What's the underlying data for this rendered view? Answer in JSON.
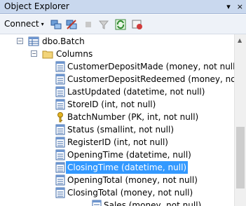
{
  "panel": {
    "title": "Object Explorer",
    "pin_glyph": "▾",
    "close_glyph": "×"
  },
  "toolbar": {
    "connect_label": "Connect",
    "caret": "▾",
    "icons": [
      "connect-object-icon",
      "disconnect-icon",
      "stop-icon",
      "filter-icon",
      "refresh-icon",
      "activity-monitor-icon"
    ]
  },
  "tree": {
    "table_node": "dbo.Batch",
    "columns_folder": "Columns",
    "columns": [
      {
        "label": "CustomerDepositMade (money, not null)",
        "icon": "column-icon"
      },
      {
        "label": "CustomerDepositRedeemed (money, not",
        "icon": "column-icon"
      },
      {
        "label": "LastUpdated (datetime, not null)",
        "icon": "column-icon"
      },
      {
        "label": "StoreID (int, not null)",
        "icon": "column-icon"
      },
      {
        "label": "BatchNumber (PK, int, not null)",
        "icon": "key-icon"
      },
      {
        "label": "Status (smallint, not null)",
        "icon": "column-icon"
      },
      {
        "label": "RegisterID (int, not null)",
        "icon": "column-icon"
      },
      {
        "label": "OpeningTime (datetime, null)",
        "icon": "column-icon"
      },
      {
        "label": "ClosingTime (datetime, null)",
        "icon": "column-icon",
        "selected": true
      },
      {
        "label": "OpeningTotal (money, not null)",
        "icon": "column-icon"
      },
      {
        "label": "ClosingTotal (money, not null)",
        "icon": "column-icon"
      },
      {
        "label": "Sales (money, not null)",
        "icon": "column-icon"
      }
    ]
  },
  "colors": {
    "selection": "#3399ff",
    "titlebar": "#c9d8ee"
  }
}
